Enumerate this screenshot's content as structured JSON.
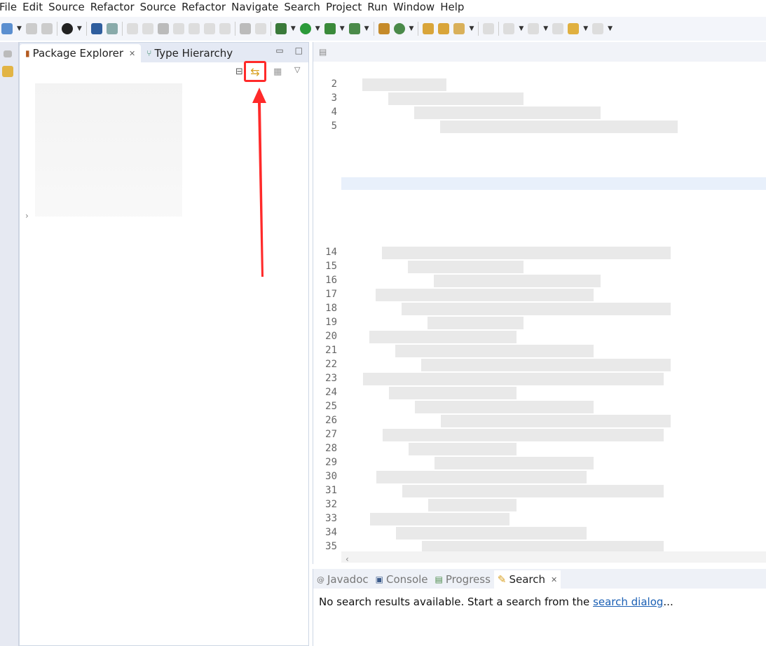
{
  "menu": [
    "File",
    "Edit",
    "Source",
    "Refactor",
    "Source",
    "Refactor",
    "Navigate",
    "Search",
    "Project",
    "Run",
    "Window",
    "Help"
  ],
  "left_panel": {
    "tabs": [
      {
        "label": "Package Explorer",
        "icon": "package-explorer-icon",
        "active": true
      },
      {
        "label": "Type Hierarchy",
        "icon": "type-hierarchy-icon",
        "active": false
      }
    ],
    "toolbar_icons": [
      "collapse-all-icon",
      "link-with-editor-icon",
      "focus-on-working-set-icon",
      "view-menu-icon"
    ],
    "highlighted": "link-with-editor-icon"
  },
  "editor": {
    "line_numbers": [
      "2",
      "3",
      "4",
      "5",
      "14",
      "15",
      "16",
      "17",
      "18",
      "19",
      "20",
      "21",
      "22",
      "23",
      "24",
      "25",
      "26",
      "27",
      "28",
      "29",
      "30",
      "31",
      "32",
      "33",
      "34",
      "35"
    ]
  },
  "bottom_panel": {
    "tabs": [
      {
        "label": "Javadoc"
      },
      {
        "label": "Console"
      },
      {
        "label": "Progress"
      },
      {
        "label": "Search",
        "active": true
      }
    ],
    "message": "No search results available. Start a search from the ",
    "link": "search dialog",
    "suffix": "..."
  },
  "colors": {
    "annotation": "#ff2a2a",
    "link": "#1a5fb4"
  }
}
